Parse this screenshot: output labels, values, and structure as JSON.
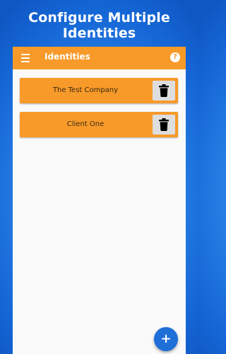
{
  "headline": "Configure Multiple Identities",
  "app_bar": {
    "title": "Identities",
    "menu_icon": "hamburger-menu-icon",
    "help_icon": "help-icon",
    "help_glyph": "?"
  },
  "identities": [
    {
      "name": "The Test Company",
      "delete_icon": "trash-icon"
    },
    {
      "name": "Client One",
      "delete_icon": "trash-icon"
    }
  ],
  "fab": {
    "label": "+",
    "icon": "plus-icon"
  },
  "colors": {
    "accent": "#f79a2a",
    "fab": "#1f6fd9",
    "background": "#2a82e6"
  }
}
